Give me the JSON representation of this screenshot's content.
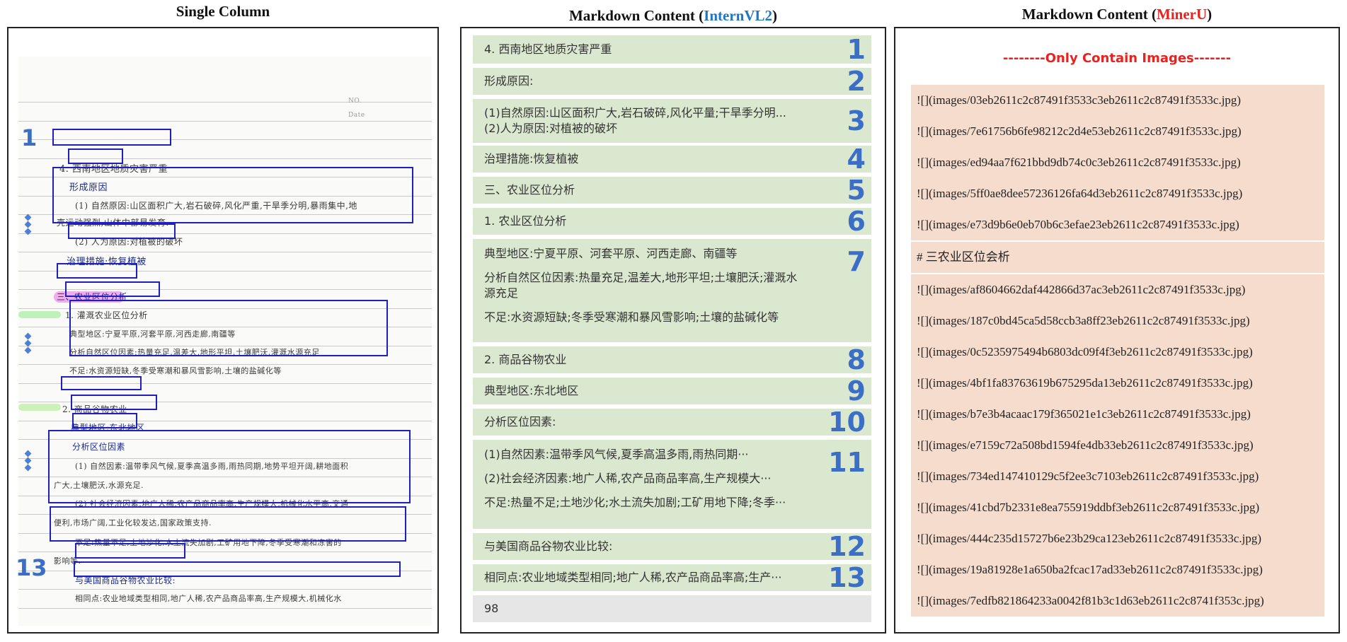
{
  "titles": {
    "single_column": "Single Column",
    "internvl_prefix": "Markdown Content (",
    "internvl_model": "InternVL2",
    "internvl_suffix": ")",
    "mineru_prefix": "Markdown Content (",
    "mineru_model": "MinerU",
    "mineru_suffix": ")"
  },
  "colors": {
    "internvl_model": "#1f77c4",
    "mineru_model": "#e8221e",
    "region_number": "#3b6fc7",
    "box": "#1f1fbf"
  },
  "notebook": {
    "header_no": "NO.",
    "header_date": "Date",
    "page_number": "98",
    "numbers": [
      "1",
      "13"
    ],
    "lines": [
      "4. 西南地区地质灾害严重",
      "形成原因",
      "(1) 自然原因:山区面积广大,岩石破碎,风化严重,干旱季分明,暴雨集中,地",
      "壳运动强烈,山体中部易发育.",
      "(2) 人为原因:对植被的破坏",
      "治理措施:恢复植被",
      "三、农业区位分析",
      "1. 灌溉农业区位分析",
      "典型地区:宁夏平原,河套平原,河西走廊,南疆等",
      "分析自然区位因素:热量充足,温差大,地形平坦,土壤肥沃,灌溉水源充足",
      "不足:水资源短缺,冬季受寒潮和暴风雪影响,土壤的盐碱化等",
      "2. 商品谷物农业",
      "典型地区:东北地区",
      "分析区位因素",
      "(1) 自然因素:温带季风气候,夏季高温多雨,雨热同期,地势平坦开阔,耕地面积",
      "广大,土壤肥沃,水源充足.",
      "(2) 社会经济因素:地广人稀,农产品商品率高,生产规模大,机械化水平高,交通",
      "便利,市场广阔,工业化较发达,国家政策支持.",
      "不足:热量不足,土地沙化,水土流失加剧,工矿用地下降,冬季受寒潮和冻害的",
      "影响等.",
      "与美国商品谷物农业比较:",
      "相同点:农业地域类型相同,地广人稀,农产品商品率高,生产规模大,机械化水"
    ]
  },
  "internvl": {
    "rows": [
      {
        "num": "1",
        "lines": [
          "4. 西南地区地质灾害严重"
        ]
      },
      {
        "num": "2",
        "lines": [
          "形成原因:"
        ]
      },
      {
        "num": "3",
        "lines": [
          "(1)自然原因:山区面积广大,岩石破碎,风化平量;干旱季分明...",
          "(2)人为原因:对植被的破坏"
        ]
      },
      {
        "num": "4",
        "lines": [
          "治理措施:恢复植被"
        ]
      },
      {
        "num": "5",
        "lines": [
          "三、农业区位分析"
        ]
      },
      {
        "num": "6",
        "lines": [
          "1. 农业区位分析"
        ]
      },
      {
        "num": "7",
        "lines": [
          "典型地区:宁夏平原、河套平原、河西走廊、南疆等",
          "",
          "分析自然区位因素:热量充足,温差大,地形平坦;土壤肥沃;灌溉水",
          "源充足",
          "",
          "不足:水资源短缺;冬季受寒潮和暴风雪影响;土壤的盐碱化等"
        ]
      },
      {
        "num": "8",
        "lines": [
          "2. 商品谷物农业"
        ]
      },
      {
        "num": "9",
        "lines": [
          "典型地区:东北地区"
        ]
      },
      {
        "num": "10",
        "lines": [
          "分析区位因素:"
        ]
      },
      {
        "num": "11",
        "lines": [
          "(1)自然因素:温带季风气候,夏季高温多雨,雨热同期···",
          "",
          "(2)社会经济因素:地广人稀,农产品商品率高,生产规模大···",
          "",
          "不足:热量不足;土地沙化;水土流失加剧;工矿用地下降;冬季···"
        ]
      },
      {
        "num": "12",
        "lines": [
          "与美国商品谷物农业比较:"
        ]
      },
      {
        "num": "13",
        "lines": [
          "相同点:农业地域类型相同;地广人稀,农产品商品率高;生产···"
        ]
      },
      {
        "num": "",
        "lines": [
          "98"
        ]
      }
    ]
  },
  "mineru": {
    "note": "--------Only Contain Images-------",
    "blocks": [
      {
        "lines": [
          "![](images/03eb2611c2c87491f3533c3eb2611c2c87491f3533c.jpg)",
          "![](images/7e61756b6fe98212c2d4e53eb2611c2c87491f3533c.jpg)",
          "![](images/ed94aa7f621bbd9db74c0c3eb2611c2c87491f3533c.jpg)",
          "![](images/5ff0ae8dee57236126fa64d3eb2611c2c87491f3533c.jpg)",
          "![](images/e73d9b6e0eb70b6c3efae23eb2611c2c87491f3533c.jpg)"
        ]
      },
      {
        "lines": [
          "# 三农业区位会析"
        ]
      },
      {
        "lines": [
          "![](images/af8604662daf442866d37ac3eb2611c2c87491f3533c.jpg)",
          "![](images/187c0bd45ca5d58ccb3a8ff23eb2611c2c87491f3533c.jpg)",
          "![](images/0c5235975494b6803dc09f4f3eb2611c2c87491f3533c.jpg)",
          "![](images/4bf1fa83763619b675295da13eb2611c2c87491f3533c.jpg)",
          "![](images/b7e3b4acaac179f365021e1c3eb2611c2c87491f3533c.jpg)",
          "![](images/e7159c72a508bd1594fe4db33eb2611c2c87491f3533c.jpg)",
          "![](images/734ed147410129c5f2ee3c7103eb2611c2c87491f3533c.jpg)",
          "![](images/41cbd7b2331e8ea755919ddbf3eb2611c2c87491f3533c.jpg)",
          "![](images/444c235d15727b6e23b29ca123eb2611c2c87491f3533c.jpg)",
          "![](images/19a81928e1a650ba2fcac17ad33eb2611c2c87491f3533c.jpg)",
          "![](images/7edfb821864233a0042f81b3c1d63eb2611c2c8741f353c.jpg)"
        ]
      }
    ]
  }
}
